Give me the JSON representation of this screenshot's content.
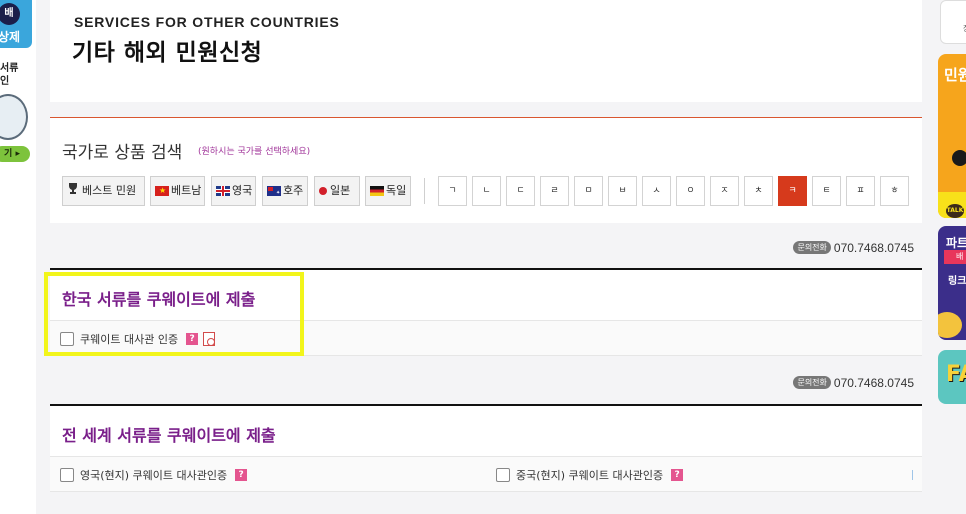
{
  "left_banner": {
    "badge": "배",
    "line1": "상제",
    "text": "서류\n인",
    "button": "기 ▸"
  },
  "right_banner": {
    "top_box_text": "장",
    "orange_text": "민원",
    "purple_text": "파트",
    "purple_ribbon": "배",
    "purple_sub": "링크",
    "teal_text": "FA"
  },
  "header": {
    "subtitle": "SERVICES FOR OTHER COUNTRIES",
    "title": "기타 해외 민원신청"
  },
  "search": {
    "title": "국가로 상품 검색",
    "hint": "(원하시는 국가를 선택하세요)",
    "countries": [
      {
        "label": "베스트 민원",
        "icon": "trophy-icon"
      },
      {
        "label": "베트남",
        "icon": "vietnam-flag-icon"
      },
      {
        "label": "영국",
        "icon": "uk-flag-icon"
      },
      {
        "label": "호주",
        "icon": "australia-flag-icon"
      },
      {
        "label": "일본",
        "icon": "japan-flag-icon"
      },
      {
        "label": "독일",
        "icon": "germany-flag-icon"
      }
    ],
    "consonants": [
      "ㄱ",
      "ㄴ",
      "ㄷ",
      "ㄹ",
      "ㅁ",
      "ㅂ",
      "ㅅ",
      "ㅇ",
      "ㅈ",
      "ㅊ",
      "ㅋ",
      "ㅌ",
      "ㅍ",
      "ㅎ"
    ],
    "active_consonant": "ㅋ",
    "accent_color": "#d63a1c"
  },
  "contact": {
    "badge": "문의전화",
    "phone": "070.7468.0745"
  },
  "sections": [
    {
      "title": "한국 서류를 쿠웨이트에 제출",
      "items": [
        {
          "label": "쿠웨이트 대사관 인증",
          "help": "?"
        }
      ]
    },
    {
      "title": "전 세계 서류를 쿠웨이트에 제출",
      "items": [
        {
          "label": "영국(현지) 쿠웨이트 대사관인증",
          "help": "?"
        },
        {
          "label": "중국(현지) 쿠웨이트 대사관인증",
          "help": "?"
        }
      ]
    }
  ],
  "highlight_color": "#f2f51b"
}
